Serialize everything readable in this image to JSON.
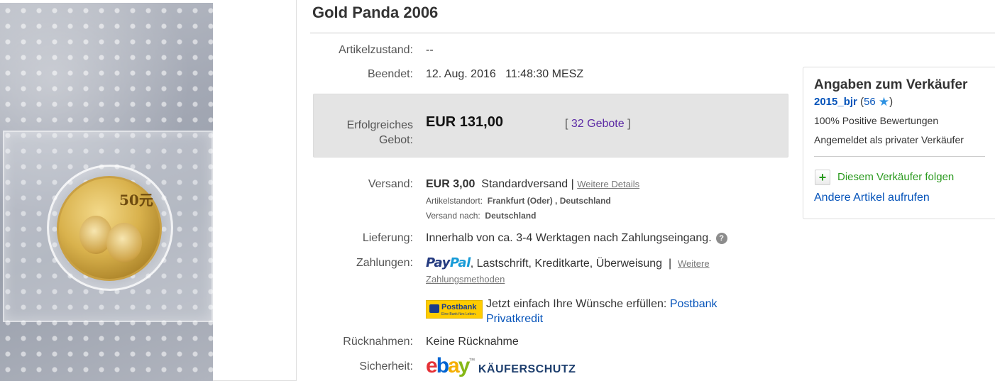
{
  "listing": {
    "title": "Gold Panda 2006",
    "coin_value_text": "50元"
  },
  "details": {
    "condition": {
      "label": "Artikelzustand:",
      "value": "--"
    },
    "ended": {
      "label": "Beendet:",
      "date": "12. Aug. 2016",
      "time": "11:48:30 MESZ"
    },
    "bid": {
      "label_line1": "Erfolgreiches",
      "label_line2": "Gebot:",
      "price": "EUR 131,00",
      "bids_open": "[",
      "bids_link": "32 Gebote",
      "bids_close": "]"
    },
    "shipping": {
      "label": "Versand:",
      "price": "EUR 3,00",
      "method": "Standardversand",
      "separator": "|",
      "details_link": "Weitere Details",
      "location_label": "Artikelstandort:",
      "location_value": "Frankfurt (Oder) , Deutschland",
      "ships_to_label": "Versand nach:",
      "ships_to_value": "Deutschland"
    },
    "delivery": {
      "label": "Lieferung:",
      "value": "Innerhalb von ca. 3-4 Werktagen nach Zahlungseingang.",
      "help_icon_text": "?"
    },
    "payments": {
      "label": "Zahlungen:",
      "paypal_part1": "Pay",
      "paypal_part2": "Pal",
      "methods": ", Lastschrift, Kreditkarte, Überweisung",
      "separator": "|",
      "more_link_line1": "Weitere",
      "more_link_line2": "Zahlungsmethoden",
      "postbank_logo_text": "Postbank",
      "postbank_logo_sub": "Eine Bank fürs Leben.",
      "postbank_promo": "Jetzt einfach Ihre Wünsche erfüllen:",
      "postbank_link_line1": "Postbank",
      "postbank_link_line2": "Privatkredit"
    },
    "returns": {
      "label": "Rücknahmen:",
      "value": "Keine Rücknahme"
    },
    "security": {
      "label": "Sicherheit:",
      "ebay_e": "e",
      "ebay_b": "b",
      "ebay_a": "a",
      "ebay_y": "y",
      "ebay_tm": "™",
      "buyer_protection": "KÄUFERSCHUTZ"
    }
  },
  "seller": {
    "heading": "Angaben zum Verkäufer",
    "name": "2015_bjr",
    "score_open": "(",
    "score": "56",
    "score_close": ")",
    "star_icon": "★",
    "positive": "100% Positive Bewertungen",
    "type": "Angemeldet als privater Verkäufer",
    "follow_icon": "+",
    "follow": "Diesem Verkäufer folgen",
    "other_items": "Andere Artikel aufrufen"
  },
  "colors": {
    "link": "#0654ba",
    "bid_link": "#5c2aa5",
    "follow_green": "#2a9a1e",
    "bid_box_bg": "#e4e4e4",
    "star": "#2e92e2"
  }
}
